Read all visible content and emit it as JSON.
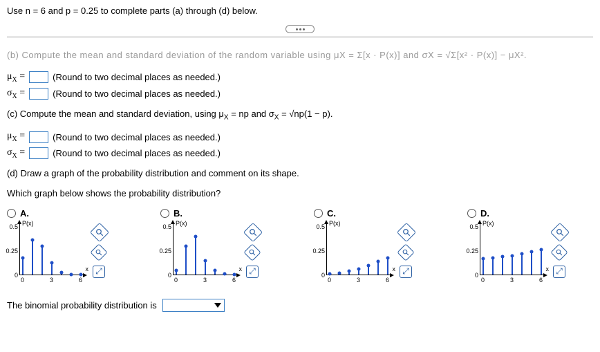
{
  "top": {
    "instruction": "Use n = 6 and p = 0.25 to complete parts (a) through (d) below."
  },
  "truncated_row": "(b) Compute the mean and standard deviation of the random variable using μX = Σ[x · P(x)] and σX = √Σ[x² · P(x)] − μX².",
  "inputs_b": {
    "mu_label": "μ",
    "mu_sub": "X",
    "eq": " = ",
    "sigma_label": "σ",
    "hint": "(Round to two decimal places as needed.)"
  },
  "part_c": {
    "text": "(c) Compute the mean and standard deviation, using μ",
    "text2": " = np and σ",
    "text3": " = √np(1 − p)."
  },
  "part_d": {
    "text": "(d) Draw a graph of the probability distribution and comment on its shape.",
    "question": "Which graph below shows the probability distribution?"
  },
  "options": {
    "A": {
      "label": "A."
    },
    "B": {
      "label": "B."
    },
    "C": {
      "label": "C."
    },
    "D": {
      "label": "D."
    }
  },
  "chart": {
    "y_label": "P(x)",
    "y_ticks": [
      "0.5",
      "0.25",
      "0"
    ],
    "x_label": "x",
    "x_ticks": [
      "0",
      "3",
      "6"
    ]
  },
  "chart_data": [
    {
      "type": "bar",
      "name": "A",
      "categories": [
        0,
        1,
        2,
        3,
        4,
        5,
        6
      ],
      "values": [
        0.18,
        0.36,
        0.3,
        0.13,
        0.03,
        0.004,
        0.0002
      ],
      "ylim": [
        0,
        0.5
      ],
      "xlabel": "x",
      "ylabel": "P(x)"
    },
    {
      "type": "bar",
      "name": "B",
      "categories": [
        0,
        1,
        2,
        3,
        4,
        5,
        6
      ],
      "values": [
        0.05,
        0.3,
        0.4,
        0.15,
        0.05,
        0.01,
        0.001
      ],
      "ylim": [
        0,
        0.5
      ],
      "xlabel": "x",
      "ylabel": "P(x)"
    },
    {
      "type": "bar",
      "name": "C",
      "categories": [
        0,
        1,
        2,
        3,
        4,
        5,
        6
      ],
      "values": [
        0.01,
        0.02,
        0.04,
        0.06,
        0.1,
        0.14,
        0.18
      ],
      "ylim": [
        0,
        0.5
      ],
      "xlabel": "x",
      "ylabel": "P(x)"
    },
    {
      "type": "bar",
      "name": "D",
      "categories": [
        0,
        1,
        2,
        3,
        4,
        5,
        6
      ],
      "values": [
        0.17,
        0.18,
        0.19,
        0.2,
        0.22,
        0.24,
        0.26
      ],
      "ylim": [
        0,
        0.5
      ],
      "xlabel": "x",
      "ylabel": "P(x)"
    }
  ],
  "bottom": {
    "text": "The binomial probability distribution is "
  },
  "icons": {
    "magnify": "⚲",
    "enlarge": "⤢"
  }
}
